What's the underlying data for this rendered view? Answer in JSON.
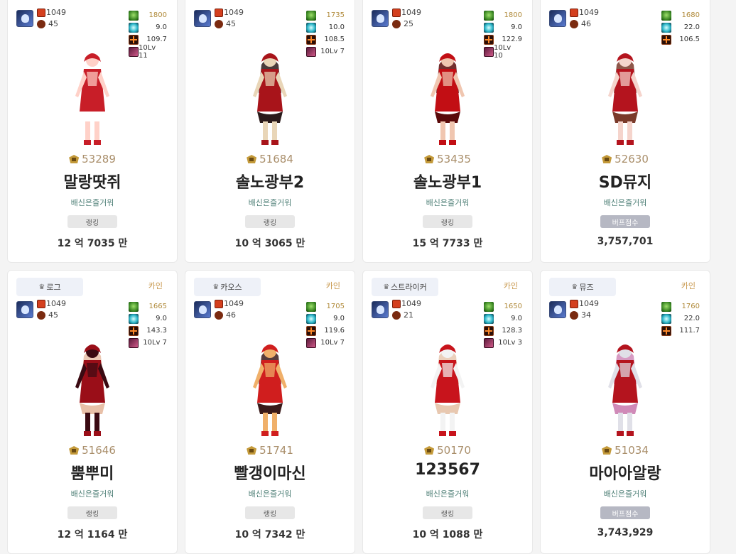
{
  "cards": [
    {
      "job": "",
      "server": "",
      "level": "1049",
      "buff_level": "45",
      "stats": [
        "1800",
        "9.0",
        "109.7",
        "10Lv 11"
      ],
      "fame": "53289",
      "name": "말랑땃쥐",
      "guild": "배신은즐거워",
      "badge": "랭킹",
      "badge_type": "rank",
      "damage": "12 억 7035 만",
      "colors": [
        "#c81e28",
        "#ffd1c8",
        "#ffffff"
      ]
    },
    {
      "job": "",
      "server": "",
      "level": "1049",
      "buff_level": "45",
      "stats": [
        "1735",
        "10.0",
        "108.5",
        "10Lv 7"
      ],
      "fame": "51684",
      "name": "솔노광부2",
      "guild": "배신은즐거워",
      "badge": "랭킹",
      "badge_type": "rank",
      "damage": "10 억 3065 만",
      "colors": [
        "#a8141a",
        "#e9d6b8",
        "#2a1a1a"
      ]
    },
    {
      "job": "",
      "server": "",
      "level": "1049",
      "buff_level": "25",
      "stats": [
        "1800",
        "9.0",
        "122.9",
        "10Lv 10"
      ],
      "fame": "53435",
      "name": "솔노광부1",
      "guild": "배신은즐거워",
      "badge": "랭킹",
      "badge_type": "rank",
      "damage": "15 억 7733 만",
      "colors": [
        "#c20e14",
        "#f0c6b0",
        "#5a0a0a"
      ]
    },
    {
      "job": "",
      "server": "",
      "level": "1049",
      "buff_level": "46",
      "stats": [
        "1680",
        "22.0",
        "106.5"
      ],
      "fame": "52630",
      "name": "SD뮤지",
      "guild": "배신은즐거워",
      "badge": "버프점수",
      "badge_type": "buff",
      "damage": "3,757,701",
      "colors": [
        "#b4141e",
        "#f5d4cc",
        "#7a3a2a"
      ]
    },
    {
      "job": "로그",
      "server": "카인",
      "level": "1049",
      "buff_level": "45",
      "stats": [
        "1665",
        "9.0",
        "143.3",
        "10Lv 7"
      ],
      "fame": "51646",
      "name": "뿜뿌미",
      "guild": "배신은즐거워",
      "badge": "랭킹",
      "badge_type": "rank",
      "damage": "12 억 1164 만",
      "colors": [
        "#9a0e18",
        "#3a0a12",
        "#e8c0a8"
      ]
    },
    {
      "job": "카오스",
      "server": "카인",
      "level": "1049",
      "buff_level": "46",
      "stats": [
        "1705",
        "9.0",
        "119.6",
        "10Lv 7"
      ],
      "fame": "51741",
      "name": "빨갱이마신",
      "guild": "배신은즐거워",
      "badge": "랭킹",
      "badge_type": "rank",
      "damage": "10 억 7342 만",
      "colors": [
        "#d01e1e",
        "#f0b06a",
        "#3a1a1a"
      ]
    },
    {
      "job": "스트라이커",
      "server": "카인",
      "level": "1049",
      "buff_level": "21",
      "stats": [
        "1650",
        "9.0",
        "128.3",
        "10Lv 3"
      ],
      "fame": "50170",
      "name": "123567",
      "guild": "배신은즐거워",
      "badge": "랭킹",
      "badge_type": "rank",
      "damage": "10 억 1088 만",
      "colors": [
        "#c8141c",
        "#f3f3f3",
        "#e8c8b0"
      ]
    },
    {
      "job": "뮤즈",
      "server": "카인",
      "level": "1049",
      "buff_level": "34",
      "stats": [
        "1760",
        "22.0",
        "111.7"
      ],
      "fame": "51034",
      "name": "마아아알랑",
      "guild": "배신은즐거워",
      "badge": "버프점수",
      "badge_type": "buff",
      "damage": "3,743,929",
      "colors": [
        "#b4141e",
        "#e0e0e8",
        "#d08ab8"
      ]
    }
  ]
}
